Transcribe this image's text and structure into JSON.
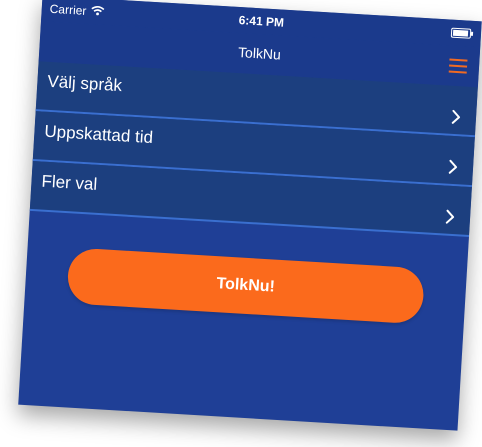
{
  "status_bar": {
    "carrier": "Carrier",
    "time": "6:41 PM",
    "wifi_icon": "wifi-icon",
    "battery_icon": "battery-icon"
  },
  "nav": {
    "title": "TolkNu",
    "menu_icon": "hamburger-menu-icon"
  },
  "menu": {
    "items": [
      {
        "label": "Välj språk",
        "icon": "chevron-right-icon"
      },
      {
        "label": "Uppskattad tid",
        "icon": "chevron-right-icon"
      },
      {
        "label": "Fler val",
        "icon": "chevron-right-icon"
      }
    ]
  },
  "cta": {
    "label": "TolkNu!"
  },
  "colors": {
    "background": "#1f3f96",
    "bar": "#1b3a8c",
    "row": "#1c3f7f",
    "row_divider": "#3a6fd0",
    "accent": "#fb6a1c",
    "menu_icon": "#f06a23"
  }
}
